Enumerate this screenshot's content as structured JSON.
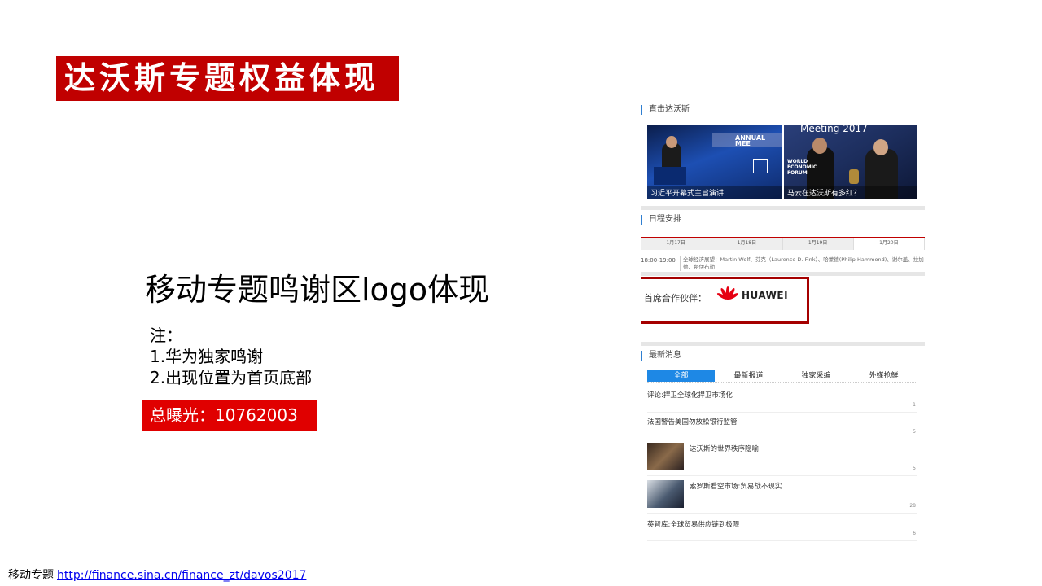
{
  "slide": {
    "title": "达沃斯专题权益体现",
    "headline": "移动专题鸣谢区logo体现",
    "note_title": "注：",
    "notes": [
      "1.华为独家鸣谢",
      "2.出现位置为首页底部"
    ],
    "exposure": "总曝光：10762003",
    "footer_label": "移动专题",
    "footer_link": "http://finance.sina.cn/finance_zt/davos2017"
  },
  "mobile_page": {
    "section_live": "直击达沃斯",
    "photos": [
      {
        "caption": "习近平开幕式主旨演讲",
        "stage_text": "ANNUAL MEE"
      },
      {
        "caption": "马云在达沃斯有多红？",
        "stage_text": "Meeting 2017"
      }
    ],
    "wef_text": "WORLD ECONOMIC FORUM",
    "section_schedule": "日程安排",
    "dates": [
      "1月17日",
      "1月18日",
      "1月19日",
      "1月20日"
    ],
    "schedule": {
      "time": "18:00-19:00",
      "detail": "全球经济展望：Martin Wolf、芬克（Laurence D. Fink）、哈蒙德(Philip Hammond)、谢尔盖、拉加德、朔伊布勒"
    },
    "partner_label": "首席合作伙伴：",
    "partner_name": "HUAWEI",
    "section_news": "最新消息",
    "news_tabs": [
      "全部",
      "最新报道",
      "独家采编",
      "外媒抢鲜"
    ],
    "news": [
      {
        "title": "评论:捍卫全球化捍卫市场化",
        "count": "1"
      },
      {
        "title": "法国警告美国勿放松银行监管",
        "count": "5"
      },
      {
        "title": "达沃斯的世界秩序隐喻",
        "count": "5"
      },
      {
        "title": "索罗斯看空市场:贸易战不现实",
        "count": "28"
      },
      {
        "title": "英智库:全球贸易供应链到极限",
        "count": "6"
      }
    ]
  },
  "colors": {
    "brand_red": "#c00000",
    "exposure_red": "#e00000",
    "partner_border": "#a50000",
    "tab_blue": "#1e88e5"
  }
}
